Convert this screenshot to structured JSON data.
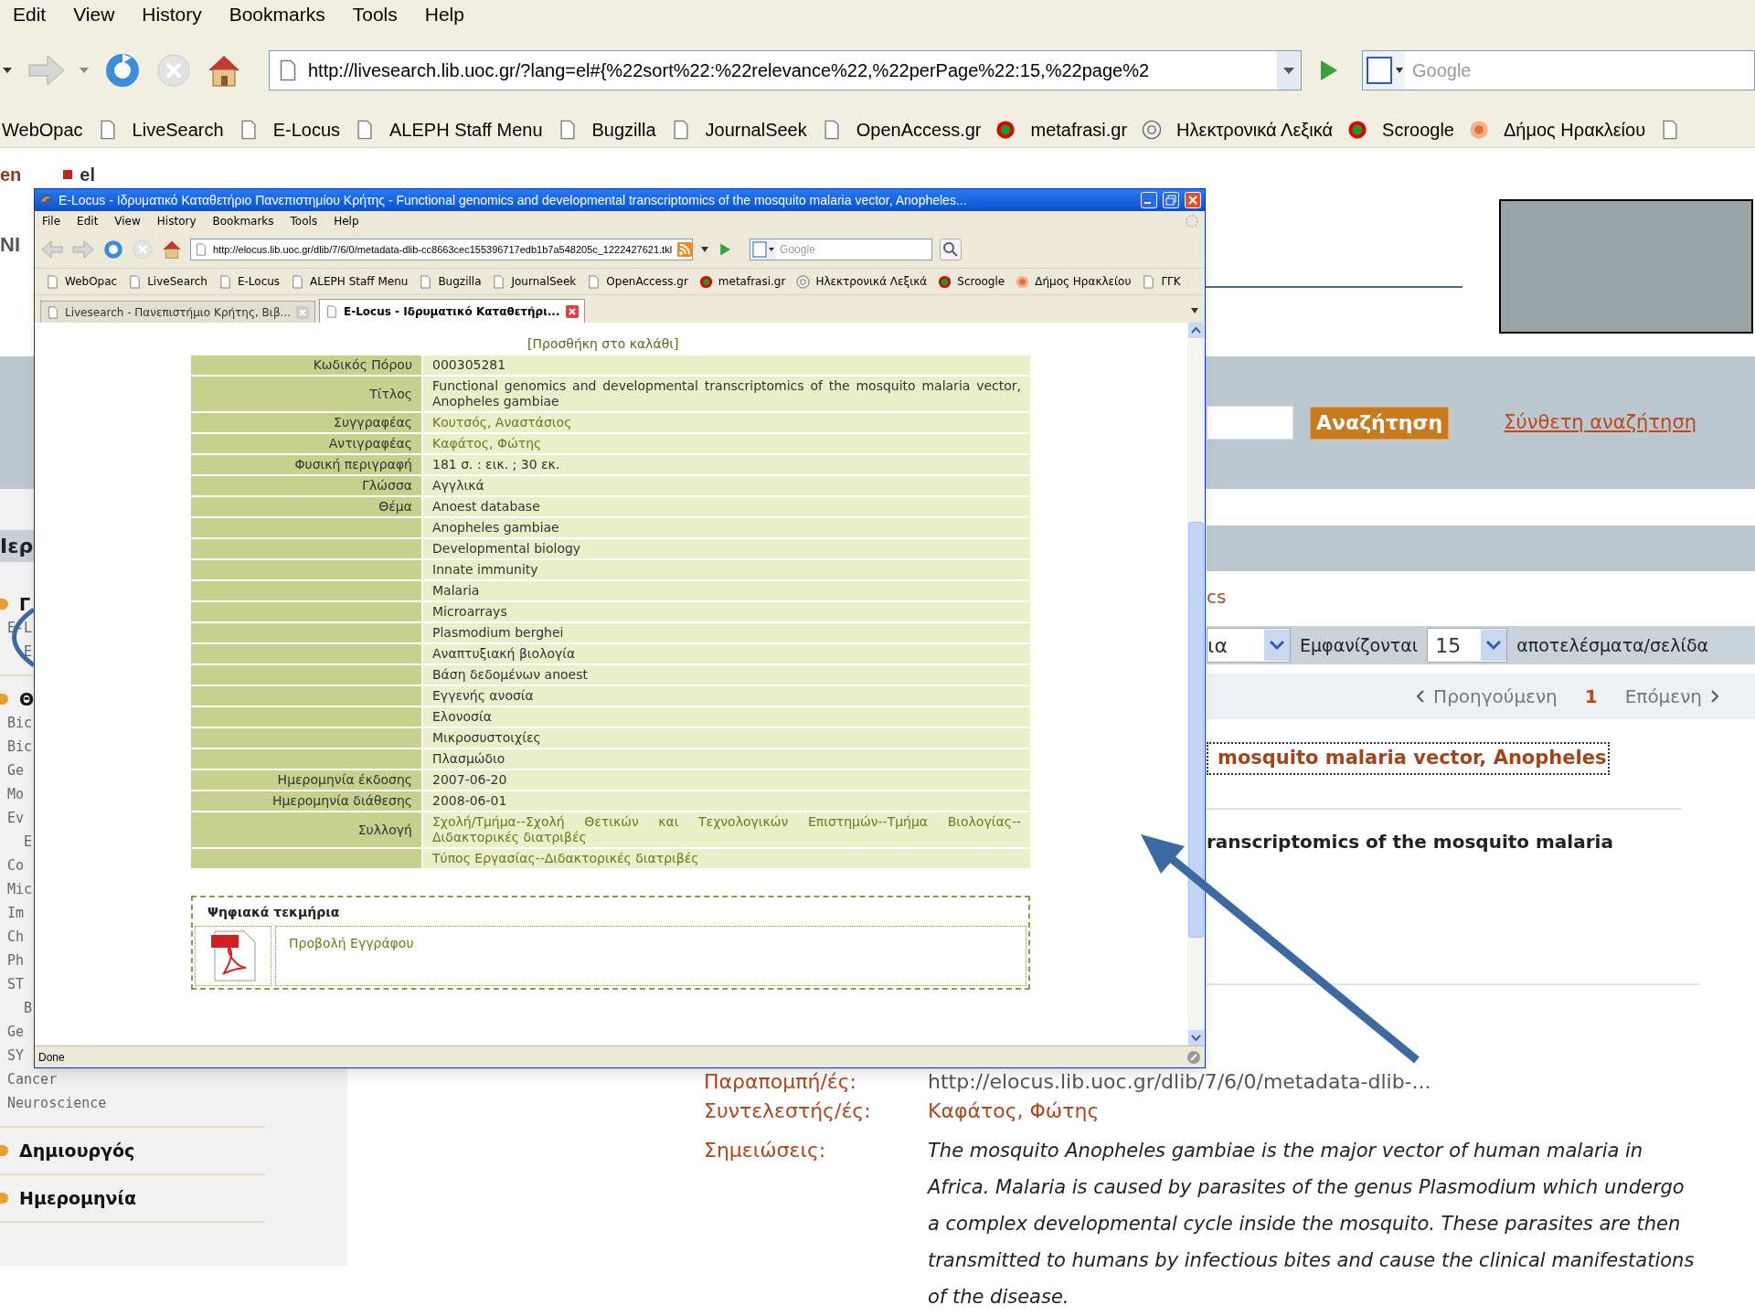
{
  "browser": {
    "menu": [
      "Edit",
      "View",
      "History",
      "Bookmarks",
      "Tools",
      "Help"
    ],
    "address": "http://livesearch.lib.uoc.gr/?lang=el#{%22sort%22:%22relevance%22,%22perPage%22:15,%22page%2",
    "search_placeholder": "Google",
    "bookmarks": [
      {
        "label": "WebOpac"
      },
      {
        "label": "LiveSearch",
        "kind": "page"
      },
      {
        "label": "E-Locus",
        "kind": "page"
      },
      {
        "label": "ALEPH Staff Menu",
        "kind": "page"
      },
      {
        "label": "Bugzilla",
        "kind": "page"
      },
      {
        "label": "JournalSeek",
        "kind": "page"
      },
      {
        "label": "OpenAccess.gr",
        "kind": "page"
      },
      {
        "label": "metafrasi.gr",
        "kind": "ring"
      },
      {
        "label": "Ηλεκτρονικά Λεξικά",
        "kind": "dict"
      },
      {
        "label": "Scroogle",
        "kind": "ring"
      },
      {
        "label": "Δήμος Ηρακλείου",
        "kind": "seal"
      }
    ]
  },
  "page": {
    "languages": [
      "en",
      "el"
    ],
    "logo_fragment": "NI",
    "search_button": "Αναζήτηση",
    "advanced_link": "Σύνθετη αναζήτηση",
    "sidebar": {
      "header": "Ιερ",
      "items": [
        {
          "text": "Γ",
          "kind": "group"
        },
        {
          "text": "E-L",
          "kind": "item"
        },
        {
          "text": "E",
          "kind": "sub"
        },
        {
          "text": "Θ",
          "kind": "group"
        },
        {
          "text": "Bic",
          "kind": "item"
        },
        {
          "text": "Bic",
          "kind": "item"
        },
        {
          "text": "Ge",
          "kind": "item"
        },
        {
          "text": "Mo",
          "kind": "item"
        },
        {
          "text": "Ev",
          "kind": "item"
        },
        {
          "text": "E",
          "kind": "sub"
        },
        {
          "text": "Co",
          "kind": "item"
        },
        {
          "text": "Mic",
          "kind": "item"
        },
        {
          "text": "Im",
          "kind": "item"
        },
        {
          "text": "Ch",
          "kind": "item"
        },
        {
          "text": "Ph",
          "kind": "item"
        },
        {
          "text": "ST",
          "kind": "item"
        },
        {
          "text": "B",
          "kind": "sub"
        },
        {
          "text": "Ge",
          "kind": "item"
        },
        {
          "text": "SY",
          "kind": "item"
        },
        {
          "text": "Cancer",
          "kind": "item"
        },
        {
          "text": "Neuroscience",
          "kind": "item"
        },
        {
          "text": "Δημιουργός",
          "kind": "group"
        },
        {
          "text": "Ημερομηνία",
          "kind": "group"
        }
      ]
    },
    "facet_fragment": "cs",
    "sort_value": "ια",
    "shown_label": "Εμφανίζονται",
    "per_page": "15",
    "per_page_suffix": "αποτελέσματα/σελίδα",
    "pagination": {
      "previous": "Προηγούμενη",
      "current": "1",
      "next": "Επόμενη"
    },
    "result_title": "mosquito malaria vector, Anopheles",
    "result_subtitle": "ranscriptomics of the mosquito malaria",
    "details": [
      {
        "label": "Παραπομπή/ές:",
        "value": "http://elocus.lib.uoc.gr/dlib/7/6/0/metadata-dlib-...",
        "kind": "url"
      },
      {
        "label": "Συντελεστής/ές:",
        "value": "Καφάτος, Φώτης",
        "kind": "link"
      },
      {
        "label": "Σημειώσεις:",
        "value": "The mosquito Anopheles gambiae is the major vector of human malaria in Africa. Malaria is caused by parasites of the genus Plasmodium which undergo a complex developmental cycle inside the mosquito. These parasites are then transmitted to humans by infectious bites and cause the clinical manifestations of the disease.",
        "kind": "note"
      }
    ]
  },
  "popup": {
    "title": "E-Locus - Ιδρυματικό Καταθετήριο Πανεπιστημίου Κρήτης - Functional genomics and developmental transcriptomics of the mosquito malaria vector, Anopheles...",
    "menu": [
      "File",
      "Edit",
      "View",
      "History",
      "Bookmarks",
      "Tools",
      "Help"
    ],
    "address": "http://elocus.lib.uoc.gr/dlib/7/6/0/metadata-dlib-cc8663cec155396717edb1b7a548205c_1222427621.tkl",
    "search_placeholder": "Google",
    "bookmarks": [
      {
        "label": "WebOpac",
        "kind": "page"
      },
      {
        "label": "LiveSearch",
        "kind": "page"
      },
      {
        "label": "E-Locus",
        "kind": "page"
      },
      {
        "label": "ALEPH Staff Menu",
        "kind": "page"
      },
      {
        "label": "Bugzilla",
        "kind": "page"
      },
      {
        "label": "JournalSeek",
        "kind": "page"
      },
      {
        "label": "OpenAccess.gr",
        "kind": "page"
      },
      {
        "label": "metafrasi.gr",
        "kind": "ring"
      },
      {
        "label": "Ηλεκτρονικά Λεξικά",
        "kind": "dict"
      },
      {
        "label": "Scroogle",
        "kind": "ring"
      },
      {
        "label": "Δήμος Ηρακλείου",
        "kind": "seal"
      },
      {
        "label": "ΓΓΚ",
        "kind": "page"
      }
    ],
    "tabs": [
      {
        "label": "Livesearch - Πανεπιστήμιο Κρήτης, Βιβ...",
        "selected": false
      },
      {
        "label": "E-Locus - Ιδρυματικό Καταθετήρι...",
        "selected": true
      }
    ],
    "basket_link": "[Προσθήκη στο καλάθι]",
    "rows": [
      {
        "label": "Κωδικός Πόρου",
        "value": "000305281",
        "link": false
      },
      {
        "label": "Τίτλος",
        "value": "Functional genomics and developmental transcriptomics of the mosquito malaria vector, Anopheles gambiae",
        "link": false
      },
      {
        "label": "Συγγραφέας",
        "value": "Κουτσός, Αναστάσιος",
        "link": true
      },
      {
        "label": "Αντιγραφέας",
        "value": "Καφάτος, Φώτης",
        "link": true
      },
      {
        "label": "Φυσική περιγραφή",
        "value": "181 σ. : εικ. ; 30 εκ.",
        "link": false
      },
      {
        "label": "Γλώσσα",
        "value": "Αγγλικά",
        "link": false
      },
      {
        "label": "Θέμα",
        "value": "Anoest database",
        "link": false
      },
      {
        "value": "Anopheles gambiae",
        "link": false
      },
      {
        "value": "Developmental biology",
        "link": false
      },
      {
        "value": "Innate immunity",
        "link": false
      },
      {
        "value": "Malaria",
        "link": false
      },
      {
        "value": "Microarrays",
        "link": false
      },
      {
        "value": "Plasmodium berghei",
        "link": false
      },
      {
        "value": "Αναπτυξιακή βιολογία",
        "link": false
      },
      {
        "value": "Βάση δεδομένων anoest",
        "link": false
      },
      {
        "value": "Εγγενής ανοσία",
        "link": false
      },
      {
        "value": "Ελονοσία",
        "link": false
      },
      {
        "value": "Μικροσυστοιχίες",
        "link": false
      },
      {
        "value": "Πλασμώδιο",
        "link": false
      },
      {
        "label": "Ημερομηνία έκδοσης",
        "value": "2007-06-20",
        "link": false
      },
      {
        "label": "Ημερομηνία διάθεσης",
        "value": "2008-06-01",
        "link": false
      },
      {
        "label": "Συλλογή",
        "value": "Σχολή/Τμήμα--Σχολή Θετικών και Τεχνολογικών Επιστημών--Τμήμα Βιολογίας--Διδακτορικές διατριβές",
        "link": true
      },
      {
        "value": "Τύπος Εργασίας--Διδακτορικές διατριβές",
        "link": true
      }
    ],
    "files_title": "Ψηφιακά τεκμήρια",
    "file_link": "Προβολή Εγγράφου",
    "status": "Done"
  }
}
